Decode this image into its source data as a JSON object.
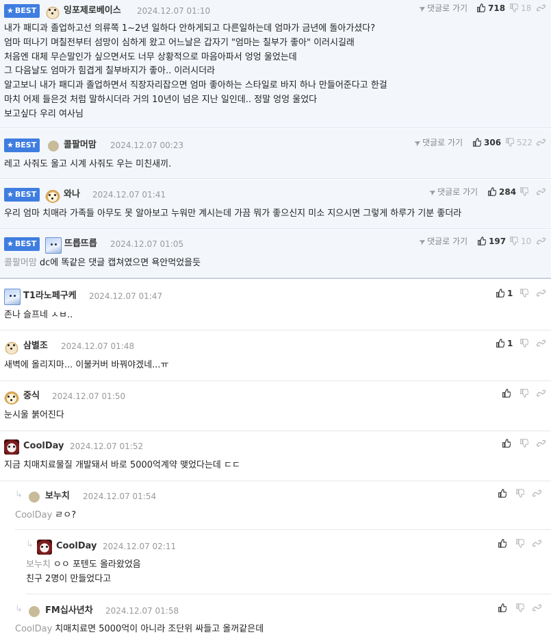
{
  "labels": {
    "best": "BEST",
    "reply_go": "댓글로 가기"
  },
  "comments": [
    {
      "nick": "잉포제로베이스",
      "date": "2024.12.07 01:10",
      "up": "718",
      "down": "18",
      "lines": [
        "내가 패디과 졸업하고선 의류쪽 1~2년 일하다 안하게되고 다른일하는데 엄마가 금년에 돌아가셨다?",
        "엄마 떠나기 며칠전부터 섬망이 심하게 왔고 어느날은 갑자기 \"엄마는 칠부가 좋아\" 이러시길래",
        "처음엔 대체 무슨말인가 싶으면서도 너무 상황적으로 마음아파서 엉엉 울었는데",
        "그 다음날도 엄마가 힘겹게 칠부바지가 좋아.. 이러시더라",
        "알고보니 내가 패디과 졸업하면서 직장자리잡으면 엄마 좋아하는 스타일로 바지 하나 만들어준다고 한걸",
        "마치 어제 들은것 처럼 말하시더라 거의 10년이 넘은 지난 일인데.. 정말 엉엉 울었다",
        "보고싶다 우리 여사님"
      ]
    },
    {
      "nick": "콜팔머맘",
      "date": "2024.12.07 00:23",
      "up": "306",
      "down": "522",
      "lines": [
        "레고 사줘도 울고 시계 사줘도 우는 미친새끼."
      ]
    },
    {
      "nick": "와나",
      "date": "2024.12.07 01:41",
      "up": "284",
      "down": "",
      "lines": [
        "우리 엄마 치매라 가족들 아무도 못 알아보고 누워만 계시는데 가끔 뭐가 좋으신지 미소 지으시면 그렇게 하루가 기분 좋더라"
      ]
    },
    {
      "nick": "뜨릅뜨릅",
      "date": "2024.12.07 01:05",
      "up": "197",
      "down": "10",
      "quote": "콜팔머맘",
      "lines": [
        "dc에 똑같은 댓글 캡쳐였으면 욕안먹었을듯"
      ]
    },
    {
      "nick": "T1라노페구케",
      "date": "2024.12.07 01:47",
      "up": "1",
      "down": "",
      "lines": [
        "존나 슬프네 ㅅㅂ.."
      ]
    },
    {
      "nick": "삼별조",
      "date": "2024.12.07 01:48",
      "up": "1",
      "down": "",
      "lines": [
        "새벽에 올리지마... 이불커버 바꿔야겠네...ㅠ"
      ]
    },
    {
      "nick": "중식",
      "date": "2024.12.07 01:50",
      "up": "",
      "down": "",
      "lines": [
        "눈시울 붉어진다"
      ]
    },
    {
      "nick": "CoolDay",
      "date": "2024.12.07 01:52",
      "up": "",
      "down": "",
      "lines": [
        "지금 치매치료물질 개발돼서 바로 5000억계약 맺었다는데 ㄷㄷ"
      ]
    },
    {
      "nick": "보누치",
      "date": "2024.12.07 01:54",
      "up": "",
      "down": "",
      "quote": "CoolDay",
      "lines": [
        "ㄹㅇ?"
      ]
    },
    {
      "nick": "CoolDay",
      "date": "2024.12.07 02:11",
      "up": "",
      "down": "",
      "quote": "보누치",
      "lines": [
        "ㅇㅇ 포텐도 올라왔었음",
        "친구 2명이 만들었다고"
      ]
    },
    {
      "nick": "FM십사년차",
      "date": "2024.12.07 01:58",
      "up": "",
      "down": "",
      "quote": "CoolDay",
      "lines": [
        "치매치료면 5000억이 아니라 조단위 싸들고 올꺼같은데"
      ]
    }
  ],
  "colors": {
    "best_badge": "#3f7ee0",
    "best_bg": "#f3f6fb",
    "date": "#999999",
    "quote": "#999999"
  },
  "icons": [
    "star-icon",
    "send-arrow-icon",
    "thumbs-up-icon",
    "thumbs-down-icon",
    "link-icon",
    "reply-arrow-icon"
  ]
}
